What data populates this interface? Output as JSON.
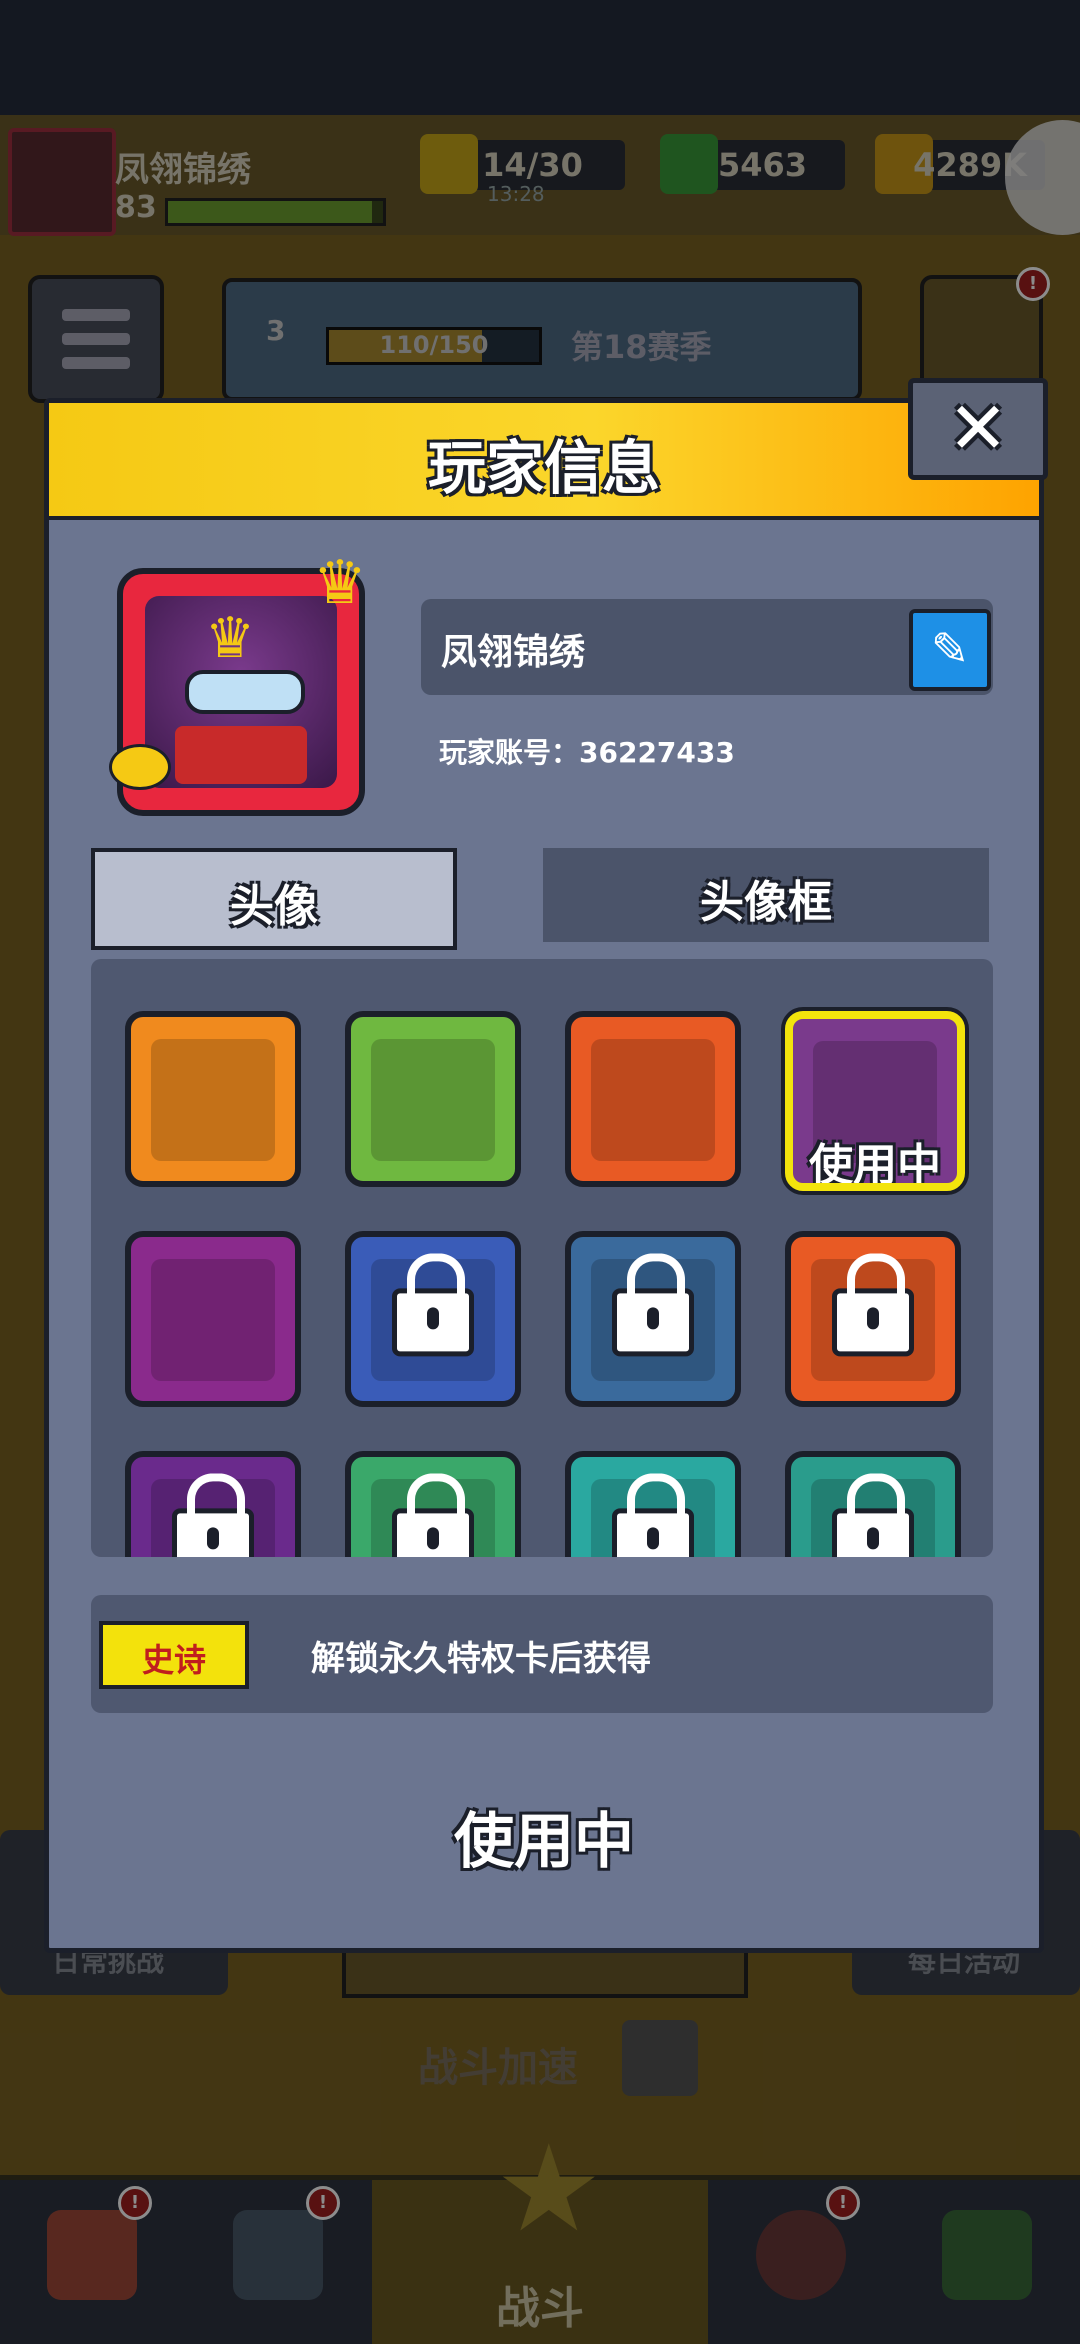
{
  "header": {
    "player_name": "凤翎锦绣",
    "level": "83",
    "energy": "14/30",
    "energy_timer": "13:28",
    "gems": "5463",
    "coins": "4289K"
  },
  "season": {
    "level": "3",
    "progress_text": "110/150",
    "progress": 0.73,
    "label": "第18赛季"
  },
  "background": {
    "left_label": "日常挑战",
    "right_label": "每日活动",
    "speed_label": "战斗加速",
    "battle_label": "战斗"
  },
  "modal": {
    "title": "玩家信息",
    "close_label": "✕",
    "player_name": "凤翎锦绣",
    "account_label": "玩家账号：36227433",
    "tabs": [
      "头像",
      "头像框"
    ],
    "avatars": [
      {
        "icon": "ninja-avatar-icon",
        "bg": "#f08a1e",
        "locked": false
      },
      {
        "icon": "cat-avatar-icon",
        "bg": "#6fb840",
        "locked": false
      },
      {
        "icon": "beaver-avatar-icon",
        "bg": "#e85a24",
        "locked": false
      },
      {
        "icon": "crowned-ninja-avatar-icon",
        "bg": "#7a3a8c",
        "locked": false,
        "selected": true
      },
      {
        "icon": "crying-cat-avatar-icon",
        "bg": "#8a2a8c",
        "locked": false
      },
      {
        "icon": "agent-avatar-icon",
        "bg": "#3a5cb8",
        "locked": true
      },
      {
        "icon": "shark-avatar-icon",
        "bg": "#3a6a9c",
        "locked": true
      },
      {
        "icon": "soldier-avatar-icon",
        "bg": "#e85a24",
        "locked": true
      },
      {
        "icon": "witch-avatar-icon",
        "bg": "#6a2a8c",
        "locked": true
      },
      {
        "icon": "monster-avatar-icon",
        "bg": "#3aa86a",
        "locked": true
      },
      {
        "icon": "starfish-avatar-icon",
        "bg": "#2aa8a0",
        "locked": true
      },
      {
        "icon": "pirate-avatar-icon",
        "bg": "#2a9c8c",
        "locked": true
      }
    ],
    "selected_tag": "使用中",
    "rarity": "史诗",
    "unlock_hint": "解锁永久特权卡后获得",
    "use_button": "使用中"
  },
  "colors": {
    "accent_yellow": "#f5c914",
    "panel": "#6b7590",
    "epic": "#f3e20c"
  }
}
